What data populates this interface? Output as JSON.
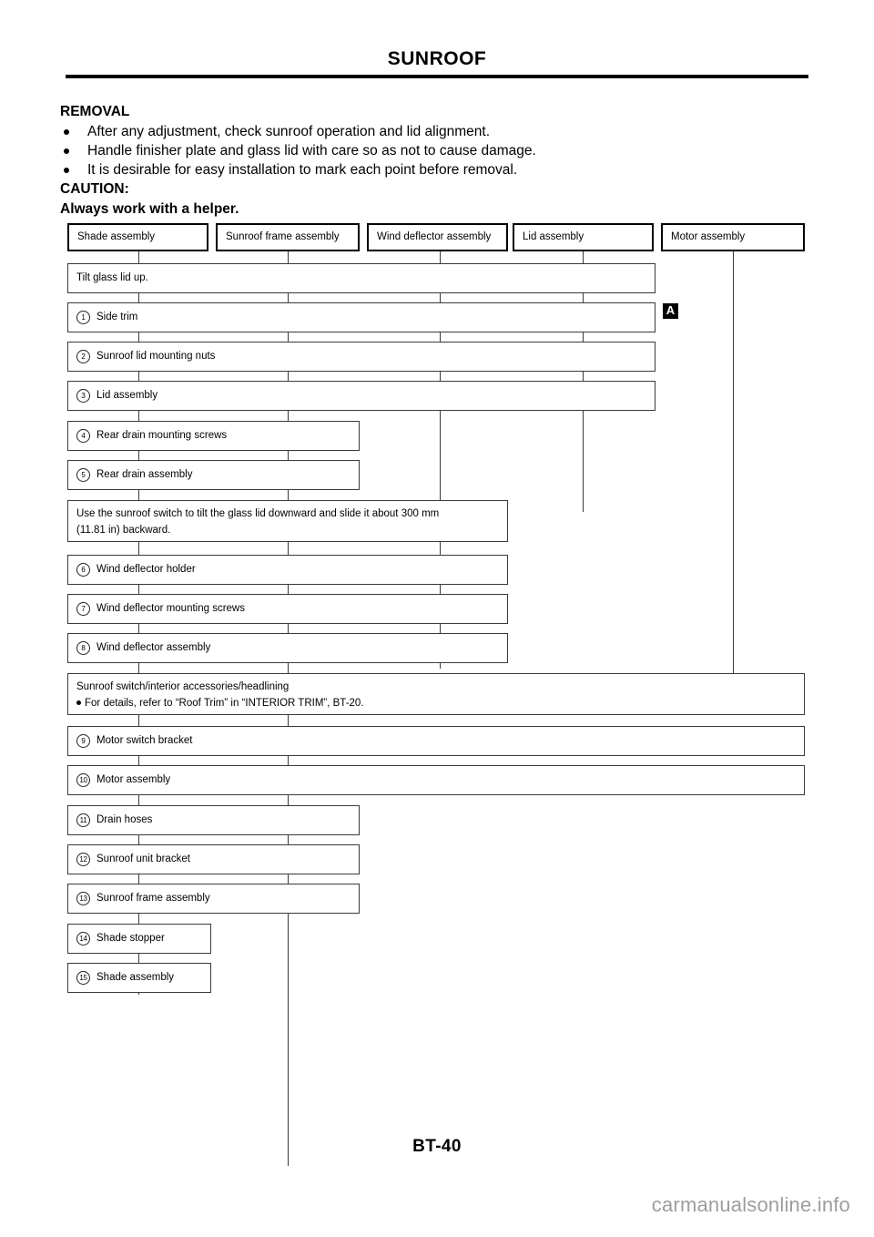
{
  "header": {
    "title": "SUNROOF"
  },
  "intro": {
    "heading": "REMOVAL",
    "bullets": [
      "After any adjustment, check sunroof operation and lid alignment.",
      "Handle finisher plate and glass lid with care so as not to cause damage.",
      "It is desirable for easy installation to mark each point before removal."
    ],
    "caution_label": "CAUTION:",
    "caution_text": "Always work with a helper."
  },
  "diagram": {
    "columns": [
      {
        "label": "Shade assembly"
      },
      {
        "label": "Sunroof frame assembly"
      },
      {
        "label": "Wind deflector assembly"
      },
      {
        "label": "Lid assembly"
      },
      {
        "label": "Motor assembly"
      }
    ],
    "marker_a": "A",
    "steps": [
      {
        "num": "",
        "label": "Tilt glass lid up."
      },
      {
        "num": "1",
        "label": "Side trim"
      },
      {
        "num": "2",
        "label": "Sunroof lid mounting nuts"
      },
      {
        "num": "3",
        "label": "Lid assembly"
      },
      {
        "num": "4",
        "label": "Rear drain mounting screws"
      },
      {
        "num": "5",
        "label": "Rear drain assembly"
      },
      {
        "num": "",
        "label": "Use the sunroof switch to tilt the glass lid downward and slide it about 300 mm (11.81 in) backward."
      },
      {
        "num": "6",
        "label": "Wind deflector holder"
      },
      {
        "num": "7",
        "label": "Wind deflector mounting screws"
      },
      {
        "num": "8",
        "label": "Wind deflector assembly"
      },
      {
        "num": "",
        "label": "Sunroof switch/interior accessories/headlining",
        "sub": "For details, refer to “Roof Trim” in “INTERIOR TRIM”, BT-20."
      },
      {
        "num": "9",
        "label": "Motor switch bracket"
      },
      {
        "num": "10",
        "label": "Motor assembly"
      },
      {
        "num": "11",
        "label": "Drain hoses"
      },
      {
        "num": "12",
        "label": "Sunroof unit bracket"
      },
      {
        "num": "13",
        "label": "Sunroof frame assembly"
      },
      {
        "num": "14",
        "label": "Shade stopper"
      },
      {
        "num": "15",
        "label": "Shade assembly"
      }
    ],
    "note_line1": "Use the sunroof switch to tilt the glass lid downward and slide it about 300 mm",
    "note_line2": "(11.81 in) backward."
  },
  "footer": {
    "folio": "BT-40",
    "watermark": "carmanualsonline.info"
  }
}
